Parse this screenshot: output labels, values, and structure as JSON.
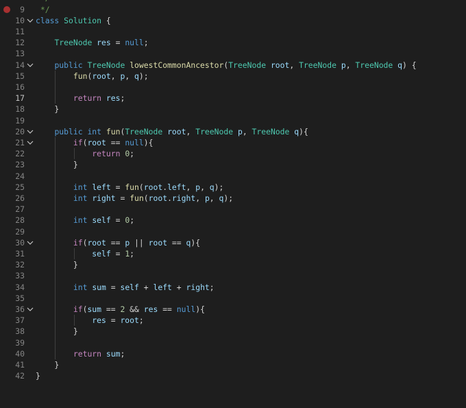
{
  "editor": {
    "active_line": "17",
    "breakpoint_line": "9",
    "lines": [
      {
        "num": "9",
        "fold": false,
        "tokens": [
          {
            "c": "c",
            "t": " */"
          }
        ]
      },
      {
        "num": "10",
        "fold": true,
        "tokens": [
          {
            "c": "k",
            "t": "class"
          },
          {
            "c": "p",
            "t": " "
          },
          {
            "c": "t",
            "t": "Solution"
          },
          {
            "c": "p",
            "t": " {"
          }
        ]
      },
      {
        "num": "11",
        "fold": false,
        "tokens": []
      },
      {
        "num": "12",
        "fold": false,
        "tokens": [
          {
            "c": "p",
            "t": "    "
          },
          {
            "c": "t",
            "t": "TreeNode"
          },
          {
            "c": "p",
            "t": " "
          },
          {
            "c": "v",
            "t": "res"
          },
          {
            "c": "p",
            "t": " = "
          },
          {
            "c": "k",
            "t": "null"
          },
          {
            "c": "p",
            "t": ";"
          }
        ]
      },
      {
        "num": "13",
        "fold": false,
        "tokens": []
      },
      {
        "num": "14",
        "fold": true,
        "tokens": [
          {
            "c": "p",
            "t": "    "
          },
          {
            "c": "k",
            "t": "public"
          },
          {
            "c": "p",
            "t": " "
          },
          {
            "c": "t",
            "t": "TreeNode"
          },
          {
            "c": "p",
            "t": " "
          },
          {
            "c": "f",
            "t": "lowestCommonAncestor"
          },
          {
            "c": "p",
            "t": "("
          },
          {
            "c": "t",
            "t": "TreeNode"
          },
          {
            "c": "p",
            "t": " "
          },
          {
            "c": "v",
            "t": "root"
          },
          {
            "c": "p",
            "t": ", "
          },
          {
            "c": "t",
            "t": "TreeNode"
          },
          {
            "c": "p",
            "t": " "
          },
          {
            "c": "v",
            "t": "p"
          },
          {
            "c": "p",
            "t": ", "
          },
          {
            "c": "t",
            "t": "TreeNode"
          },
          {
            "c": "p",
            "t": " "
          },
          {
            "c": "v",
            "t": "q"
          },
          {
            "c": "p",
            "t": ") {"
          }
        ]
      },
      {
        "num": "15",
        "fold": false,
        "tokens": [
          {
            "c": "p",
            "t": "        "
          },
          {
            "c": "f",
            "t": "fun"
          },
          {
            "c": "p",
            "t": "("
          },
          {
            "c": "v",
            "t": "root"
          },
          {
            "c": "p",
            "t": ", "
          },
          {
            "c": "v",
            "t": "p"
          },
          {
            "c": "p",
            "t": ", "
          },
          {
            "c": "v",
            "t": "q"
          },
          {
            "c": "p",
            "t": ");"
          }
        ]
      },
      {
        "num": "16",
        "fold": false,
        "tokens": []
      },
      {
        "num": "17",
        "fold": false,
        "tokens": [
          {
            "c": "p",
            "t": "        "
          },
          {
            "c": "kc",
            "t": "return"
          },
          {
            "c": "p",
            "t": " "
          },
          {
            "c": "v",
            "t": "res"
          },
          {
            "c": "p",
            "t": ";"
          }
        ]
      },
      {
        "num": "18",
        "fold": false,
        "tokens": [
          {
            "c": "p",
            "t": "    }"
          }
        ]
      },
      {
        "num": "19",
        "fold": false,
        "tokens": []
      },
      {
        "num": "20",
        "fold": true,
        "tokens": [
          {
            "c": "p",
            "t": "    "
          },
          {
            "c": "k",
            "t": "public"
          },
          {
            "c": "p",
            "t": " "
          },
          {
            "c": "k",
            "t": "int"
          },
          {
            "c": "p",
            "t": " "
          },
          {
            "c": "f",
            "t": "fun"
          },
          {
            "c": "p",
            "t": "("
          },
          {
            "c": "t",
            "t": "TreeNode"
          },
          {
            "c": "p",
            "t": " "
          },
          {
            "c": "v",
            "t": "root"
          },
          {
            "c": "p",
            "t": ", "
          },
          {
            "c": "t",
            "t": "TreeNode"
          },
          {
            "c": "p",
            "t": " "
          },
          {
            "c": "v",
            "t": "p"
          },
          {
            "c": "p",
            "t": ", "
          },
          {
            "c": "t",
            "t": "TreeNode"
          },
          {
            "c": "p",
            "t": " "
          },
          {
            "c": "v",
            "t": "q"
          },
          {
            "c": "p",
            "t": "){"
          }
        ]
      },
      {
        "num": "21",
        "fold": true,
        "tokens": [
          {
            "c": "p",
            "t": "        "
          },
          {
            "c": "kc",
            "t": "if"
          },
          {
            "c": "p",
            "t": "("
          },
          {
            "c": "v",
            "t": "root"
          },
          {
            "c": "p",
            "t": " == "
          },
          {
            "c": "k",
            "t": "null"
          },
          {
            "c": "p",
            "t": "){"
          }
        ]
      },
      {
        "num": "22",
        "fold": false,
        "tokens": [
          {
            "c": "p",
            "t": "            "
          },
          {
            "c": "kc",
            "t": "return"
          },
          {
            "c": "p",
            "t": " "
          },
          {
            "c": "n",
            "t": "0"
          },
          {
            "c": "p",
            "t": ";"
          }
        ]
      },
      {
        "num": "23",
        "fold": false,
        "tokens": [
          {
            "c": "p",
            "t": "        }"
          }
        ]
      },
      {
        "num": "24",
        "fold": false,
        "tokens": []
      },
      {
        "num": "25",
        "fold": false,
        "tokens": [
          {
            "c": "p",
            "t": "        "
          },
          {
            "c": "k",
            "t": "int"
          },
          {
            "c": "p",
            "t": " "
          },
          {
            "c": "v",
            "t": "left"
          },
          {
            "c": "p",
            "t": " = "
          },
          {
            "c": "f",
            "t": "fun"
          },
          {
            "c": "p",
            "t": "("
          },
          {
            "c": "v",
            "t": "root"
          },
          {
            "c": "p",
            "t": "."
          },
          {
            "c": "v",
            "t": "left"
          },
          {
            "c": "p",
            "t": ", "
          },
          {
            "c": "v",
            "t": "p"
          },
          {
            "c": "p",
            "t": ", "
          },
          {
            "c": "v",
            "t": "q"
          },
          {
            "c": "p",
            "t": ");"
          }
        ]
      },
      {
        "num": "26",
        "fold": false,
        "tokens": [
          {
            "c": "p",
            "t": "        "
          },
          {
            "c": "k",
            "t": "int"
          },
          {
            "c": "p",
            "t": " "
          },
          {
            "c": "v",
            "t": "right"
          },
          {
            "c": "p",
            "t": " = "
          },
          {
            "c": "f",
            "t": "fun"
          },
          {
            "c": "p",
            "t": "("
          },
          {
            "c": "v",
            "t": "root"
          },
          {
            "c": "p",
            "t": "."
          },
          {
            "c": "v",
            "t": "right"
          },
          {
            "c": "p",
            "t": ", "
          },
          {
            "c": "v",
            "t": "p"
          },
          {
            "c": "p",
            "t": ", "
          },
          {
            "c": "v",
            "t": "q"
          },
          {
            "c": "p",
            "t": ");"
          }
        ]
      },
      {
        "num": "27",
        "fold": false,
        "tokens": []
      },
      {
        "num": "28",
        "fold": false,
        "tokens": [
          {
            "c": "p",
            "t": "        "
          },
          {
            "c": "k",
            "t": "int"
          },
          {
            "c": "p",
            "t": " "
          },
          {
            "c": "v",
            "t": "self"
          },
          {
            "c": "p",
            "t": " = "
          },
          {
            "c": "n",
            "t": "0"
          },
          {
            "c": "p",
            "t": ";"
          }
        ]
      },
      {
        "num": "29",
        "fold": false,
        "tokens": []
      },
      {
        "num": "30",
        "fold": true,
        "tokens": [
          {
            "c": "p",
            "t": "        "
          },
          {
            "c": "kc",
            "t": "if"
          },
          {
            "c": "p",
            "t": "("
          },
          {
            "c": "v",
            "t": "root"
          },
          {
            "c": "p",
            "t": " == "
          },
          {
            "c": "v",
            "t": "p"
          },
          {
            "c": "p",
            "t": " || "
          },
          {
            "c": "v",
            "t": "root"
          },
          {
            "c": "p",
            "t": " == "
          },
          {
            "c": "v",
            "t": "q"
          },
          {
            "c": "p",
            "t": "){"
          }
        ]
      },
      {
        "num": "31",
        "fold": false,
        "tokens": [
          {
            "c": "p",
            "t": "            "
          },
          {
            "c": "v",
            "t": "self"
          },
          {
            "c": "p",
            "t": " = "
          },
          {
            "c": "n",
            "t": "1"
          },
          {
            "c": "p",
            "t": ";"
          }
        ]
      },
      {
        "num": "32",
        "fold": false,
        "tokens": [
          {
            "c": "p",
            "t": "        }"
          }
        ]
      },
      {
        "num": "33",
        "fold": false,
        "tokens": []
      },
      {
        "num": "34",
        "fold": false,
        "tokens": [
          {
            "c": "p",
            "t": "        "
          },
          {
            "c": "k",
            "t": "int"
          },
          {
            "c": "p",
            "t": " "
          },
          {
            "c": "v",
            "t": "sum"
          },
          {
            "c": "p",
            "t": " = "
          },
          {
            "c": "v",
            "t": "self"
          },
          {
            "c": "p",
            "t": " + "
          },
          {
            "c": "v",
            "t": "left"
          },
          {
            "c": "p",
            "t": " + "
          },
          {
            "c": "v",
            "t": "right"
          },
          {
            "c": "p",
            "t": ";"
          }
        ]
      },
      {
        "num": "35",
        "fold": false,
        "tokens": []
      },
      {
        "num": "36",
        "fold": true,
        "tokens": [
          {
            "c": "p",
            "t": "        "
          },
          {
            "c": "kc",
            "t": "if"
          },
          {
            "c": "p",
            "t": "("
          },
          {
            "c": "v",
            "t": "sum"
          },
          {
            "c": "p",
            "t": " == "
          },
          {
            "c": "n",
            "t": "2"
          },
          {
            "c": "p",
            "t": " && "
          },
          {
            "c": "v",
            "t": "res"
          },
          {
            "c": "p",
            "t": " == "
          },
          {
            "c": "k",
            "t": "null"
          },
          {
            "c": "p",
            "t": "){"
          }
        ]
      },
      {
        "num": "37",
        "fold": false,
        "tokens": [
          {
            "c": "p",
            "t": "            "
          },
          {
            "c": "v",
            "t": "res"
          },
          {
            "c": "p",
            "t": " = "
          },
          {
            "c": "v",
            "t": "root"
          },
          {
            "c": "p",
            "t": ";"
          }
        ]
      },
      {
        "num": "38",
        "fold": false,
        "tokens": [
          {
            "c": "p",
            "t": "        }"
          }
        ]
      },
      {
        "num": "39",
        "fold": false,
        "tokens": []
      },
      {
        "num": "40",
        "fold": false,
        "tokens": [
          {
            "c": "p",
            "t": "        "
          },
          {
            "c": "kc",
            "t": "return"
          },
          {
            "c": "p",
            "t": " "
          },
          {
            "c": "v",
            "t": "sum"
          },
          {
            "c": "p",
            "t": ";"
          }
        ]
      },
      {
        "num": "41",
        "fold": false,
        "tokens": [
          {
            "c": "p",
            "t": "    }"
          }
        ]
      },
      {
        "num": "42",
        "fold": false,
        "tokens": [
          {
            "c": "p",
            "t": "}"
          }
        ]
      }
    ],
    "top_comment": " */"
  }
}
